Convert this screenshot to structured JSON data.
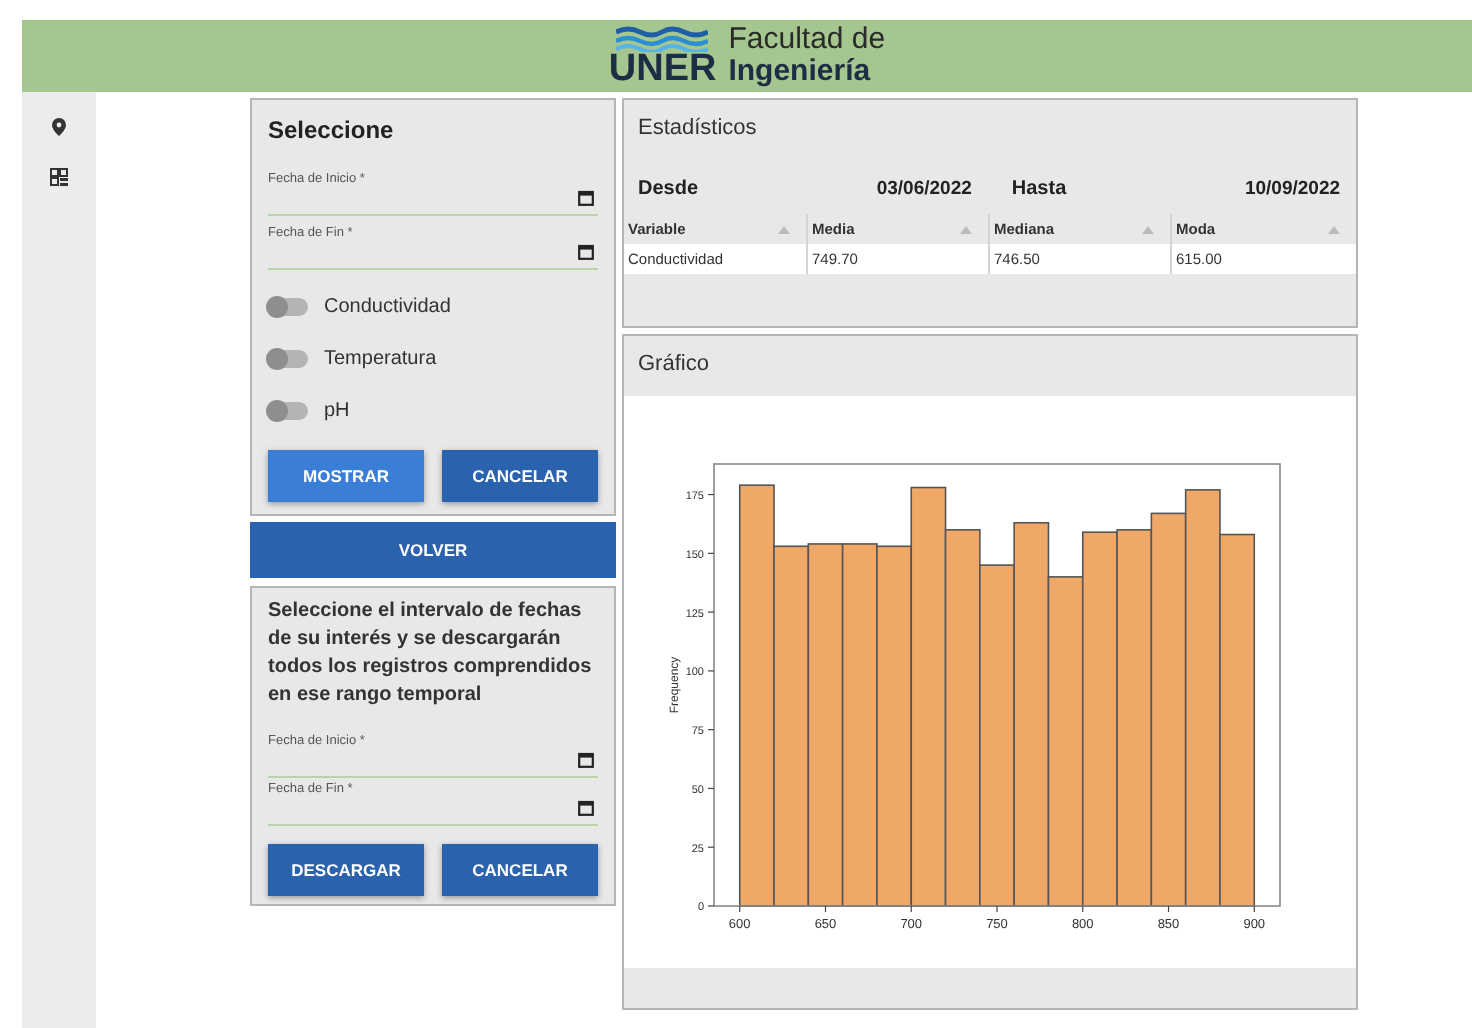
{
  "header": {
    "logo_mark": "UNER",
    "logo_line1": "Facultad de",
    "logo_line2": "Ingeniería"
  },
  "select_panel": {
    "title": "Seleccione",
    "date_fields": [
      {
        "label": "Fecha de Inicio *"
      },
      {
        "label": "Fecha de Fin *"
      }
    ],
    "toggles": [
      {
        "label": "Conductividad",
        "on": false
      },
      {
        "label": "Temperatura",
        "on": false
      },
      {
        "label": "pH",
        "on": false
      }
    ],
    "buttons": [
      {
        "label": "MOSTRAR",
        "kind": "primary"
      },
      {
        "label": "CANCELAR",
        "kind": "secondary"
      }
    ]
  },
  "back_button": "VOLVER",
  "download_panel": {
    "instructions": "Seleccione el intervalo de fechas de su interés y se descargarán todos los registros comprendidos en ese rango temporal",
    "date_fields": [
      {
        "label": "Fecha de Inicio *"
      },
      {
        "label": "Fecha de Fin *"
      }
    ],
    "buttons": [
      {
        "label": "DESCARGAR",
        "kind": "secondary"
      },
      {
        "label": "CANCELAR",
        "kind": "secondary"
      }
    ]
  },
  "stats_panel": {
    "title": "Estadísticos",
    "from_label": "Desde",
    "from_value": "03/06/2022",
    "to_label": "Hasta",
    "to_value": "10/09/2022",
    "table": {
      "columns": [
        "Variable",
        "Media",
        "Mediana",
        "Moda"
      ],
      "rows": [
        [
          "Conductividad",
          "749.70",
          "746.50",
          "615.00"
        ]
      ]
    }
  },
  "chart_panel": {
    "title": "Gráfico",
    "chart_data": {
      "type": "bar",
      "ylabel": "Frequency",
      "x": [
        610,
        630,
        650,
        670,
        690,
        710,
        730,
        750,
        770,
        790,
        810,
        830,
        850,
        870,
        890
      ],
      "series": [
        {
          "color": "#f0a868",
          "values": [
            179,
            153,
            154,
            154,
            153,
            178,
            160,
            145,
            163,
            140,
            159,
            160,
            167,
            177,
            158
          ]
        }
      ],
      "xlim": [
        585,
        915
      ],
      "ylim": [
        0,
        188
      ],
      "xticks": [
        600,
        650,
        700,
        750,
        800,
        850,
        900
      ],
      "yticks": [
        0,
        25,
        50,
        75,
        100,
        125,
        150,
        175
      ]
    }
  }
}
